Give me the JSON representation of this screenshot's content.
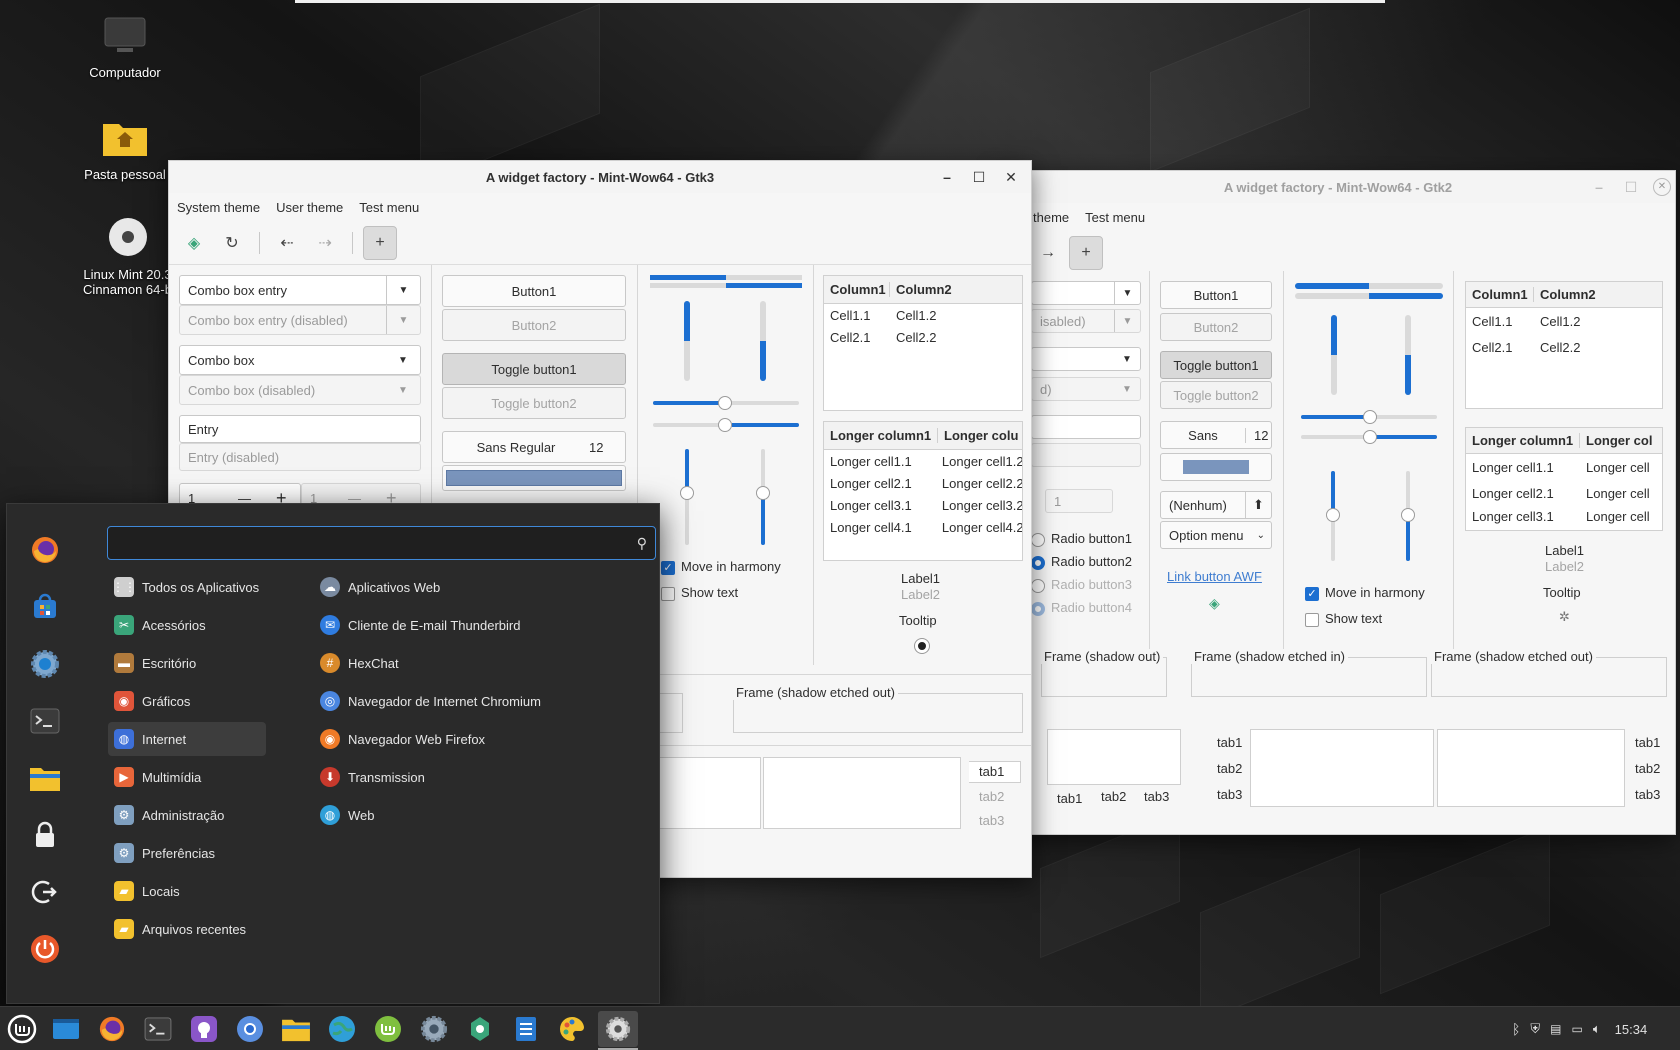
{
  "desktop": {
    "icons": [
      {
        "label": "Computador",
        "icon": "monitor-icon"
      },
      {
        "label": "Pasta pessoal",
        "icon": "home-folder-icon"
      },
      {
        "label": "Linux Mint 20.3 Cinnamon 64-b",
        "icon": "disc-icon"
      }
    ]
  },
  "gtk3": {
    "title": "A widget factory - Mint-Wow64 - Gtk3",
    "controls": {
      "minimize": "–",
      "maximize": "☐",
      "close": "✕"
    },
    "menus": [
      "System theme",
      "User theme",
      "Test menu"
    ],
    "combo_entry": "Combo box entry",
    "combo_entry_disabled": "Combo box entry (disabled)",
    "combo": "Combo box",
    "combo_disabled": "Combo box (disabled)",
    "entry": "Entry",
    "entry_disabled": "Entry (disabled)",
    "spin1": "1",
    "spin2": "1",
    "button1": "Button1",
    "button2": "Button2",
    "toggle1": "Toggle button1",
    "toggle2": "Toggle button2",
    "font_name": "Sans Regular",
    "font_size": "12",
    "table1": {
      "headers": [
        "Column1",
        "Column2"
      ],
      "rows": [
        [
          "Cell1.1",
          "Cell1.2"
        ],
        [
          "Cell2.1",
          "Cell2.2"
        ]
      ]
    },
    "table2": {
      "headers": [
        "Longer column1",
        "Longer colu"
      ],
      "rows": [
        [
          "Longer cell1.1",
          "Longer cell1.2"
        ],
        [
          "Longer cell2.1",
          "Longer cell2.2"
        ],
        [
          "Longer cell3.1",
          "Longer cell3.2"
        ],
        [
          "Longer cell4.1",
          "Longer cell4.2"
        ]
      ]
    },
    "move_in_harmony": "Move in harmony",
    "show_text": "Show text",
    "label1": "Label1",
    "label2": "Label2",
    "tooltip": "Tooltip",
    "frame_etched_out": "Frame (shadow etched out)",
    "tabs": [
      "tab1",
      "tab2",
      "tab3"
    ],
    "progress_h": [
      0.5,
      0.5
    ],
    "progress_v": [
      0.55,
      0.55
    ],
    "slider_h": [
      0.45,
      0.45
    ]
  },
  "gtk2": {
    "title": "A widget factory - Mint-Wow64 - Gtk2",
    "controls": {
      "minimize": "–",
      "maximize": "☐",
      "close": "✕"
    },
    "menus": [
      "theme",
      "Test menu"
    ],
    "combo_entry_disabled": "isabled)",
    "combo_disabled": "d)",
    "spin": "1",
    "button1": "Button1",
    "button2": "Button2",
    "toggle1": "Toggle button1",
    "toggle2": "Toggle button2",
    "font_name": "Sans",
    "font_size": "12",
    "file_chooser": "(Nenhum)",
    "option_menu": "Option menu",
    "radios": [
      "Radio button1",
      "Radio button2",
      "Radio button3",
      "Radio button4"
    ],
    "link_button": "Link button AWF",
    "move_in_harmony": "Move in harmony",
    "show_text": "Show text",
    "table1": {
      "headers": [
        "Column1",
        "Column2"
      ],
      "rows": [
        [
          "Cell1.1",
          "Cell1.2"
        ],
        [
          "Cell2.1",
          "Cell2.2"
        ]
      ]
    },
    "table2": {
      "headers": [
        "Longer column1",
        "Longer col"
      ],
      "rows": [
        [
          "Longer cell1.1",
          "Longer cell"
        ],
        [
          "Longer cell2.1",
          "Longer cell"
        ],
        [
          "Longer cell3.1",
          "Longer cell"
        ]
      ]
    },
    "label1": "Label1",
    "label2": "Label2",
    "tooltip": "Tooltip",
    "frames": [
      "Frame (shadow out)",
      "Frame (shadow etched in)",
      "Frame (shadow etched out)"
    ],
    "tabs": [
      "tab1",
      "tab2",
      "tab3"
    ]
  },
  "menu": {
    "search_placeholder": "",
    "categories": [
      {
        "label": "Todos os Aplicativos",
        "icon": "grid-icon",
        "color": "#cfcfcf"
      },
      {
        "label": "Acessórios",
        "icon": "accessories-icon",
        "color": "#3aa57a"
      },
      {
        "label": "Escritório",
        "icon": "briefcase-icon",
        "color": "#b07a3c"
      },
      {
        "label": "Gráficos",
        "icon": "graphics-icon",
        "color": "#e0553a"
      },
      {
        "label": "Internet",
        "icon": "internet-icon",
        "color": "#3d6fd8"
      },
      {
        "label": "Multimídia",
        "icon": "play-icon",
        "color": "#e8663a"
      },
      {
        "label": "Administração",
        "icon": "gear-icon",
        "color": "#7f9fbf"
      },
      {
        "label": "Preferências",
        "icon": "preferences-icon",
        "color": "#7f9fbf"
      },
      {
        "label": "Locais",
        "icon": "folder-icon",
        "color": "#f2c12e"
      },
      {
        "label": "Arquivos recentes",
        "icon": "recent-files-icon",
        "color": "#f2c12e"
      }
    ],
    "apps": [
      {
        "label": "Aplicativos Web",
        "icon": "webapps-icon",
        "color": "#7a8aa0"
      },
      {
        "label": "Cliente de E-mail Thunderbird",
        "icon": "thunderbird-icon",
        "color": "#2f7ce0"
      },
      {
        "label": "HexChat",
        "icon": "hexchat-icon",
        "color": "#d98a2b"
      },
      {
        "label": "Navegador de Internet Chromium",
        "icon": "chromium-icon",
        "color": "#4a86e0"
      },
      {
        "label": "Navegador Web Firefox",
        "icon": "firefox-icon",
        "color": "#f07a26"
      },
      {
        "label": "Transmission",
        "icon": "transmission-icon",
        "color": "#c7392c"
      },
      {
        "label": "Web",
        "icon": "web-icon",
        "color": "#2f9fd8"
      }
    ],
    "favorites": [
      "firefox-icon",
      "software-manager-icon",
      "settings-icon",
      "terminal-icon",
      "files-icon",
      "lock-icon",
      "logout-icon",
      "power-icon"
    ]
  },
  "taskbar": {
    "items": [
      "mint-menu-icon",
      "show-desktop-icon",
      "firefox-icon",
      "terminal-icon",
      "github-icon",
      "chromium-icon",
      "files-icon",
      "globe-icon",
      "mintupdate-icon",
      "settings-icon",
      "gimp-icon",
      "text-editor-icon",
      "color-palette-icon",
      "widget-factory-icon"
    ],
    "tray": [
      "bluetooth-icon",
      "shield-icon",
      "clipboard-icon",
      "display-icon",
      "volume-icon"
    ],
    "clock": "15:34"
  }
}
